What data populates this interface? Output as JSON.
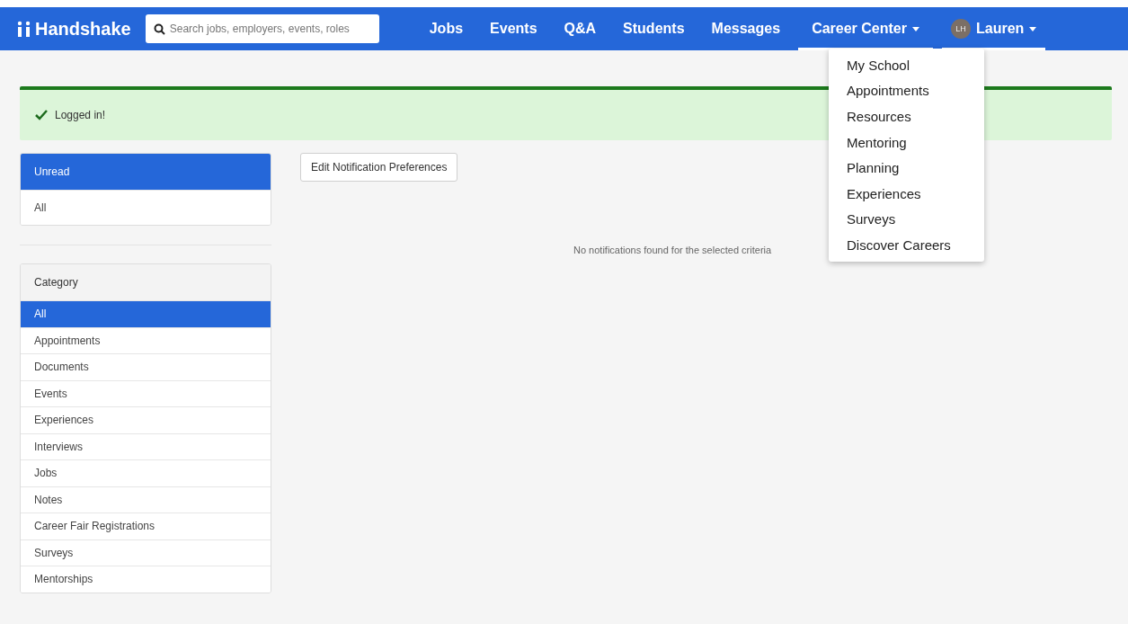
{
  "navbar": {
    "brand": "Handshake",
    "search": {
      "placeholder": "Search jobs, employers, events, roles"
    },
    "links": [
      {
        "label": "Jobs",
        "kind": "link",
        "selected": false
      },
      {
        "label": "Events",
        "kind": "link",
        "selected": false
      },
      {
        "label": "Q&A",
        "kind": "link",
        "selected": false
      },
      {
        "label": "Students",
        "kind": "link",
        "selected": false
      },
      {
        "label": "Messages",
        "kind": "link",
        "selected": false
      },
      {
        "label": "Career Center",
        "kind": "dropdown",
        "selected": true
      },
      {
        "label": "Lauren",
        "kind": "user",
        "initials": "LH",
        "selected": true
      }
    ]
  },
  "dropdown": {
    "items": [
      "My School",
      "Appointments",
      "Resources",
      "Mentoring",
      "Planning",
      "Experiences",
      "Surveys",
      "Discover Careers"
    ]
  },
  "alert": {
    "message": "Logged in!"
  },
  "read_filter": [
    {
      "label": "Unread",
      "selected": true
    },
    {
      "label": "All",
      "selected": false
    }
  ],
  "category": {
    "title": "Category",
    "items": [
      {
        "label": "All",
        "selected": true
      },
      {
        "label": "Appointments",
        "selected": false
      },
      {
        "label": "Documents",
        "selected": false
      },
      {
        "label": "Events",
        "selected": false
      },
      {
        "label": "Experiences",
        "selected": false
      },
      {
        "label": "Interviews",
        "selected": false
      },
      {
        "label": "Jobs",
        "selected": false
      },
      {
        "label": "Notes",
        "selected": false
      },
      {
        "label": "Career Fair Registrations",
        "selected": false
      },
      {
        "label": "Surveys",
        "selected": false
      },
      {
        "label": "Mentorships",
        "selected": false
      }
    ]
  },
  "edit_button": "Edit Notification Preferences",
  "empty_message": "No notifications found for the selected criteria"
}
